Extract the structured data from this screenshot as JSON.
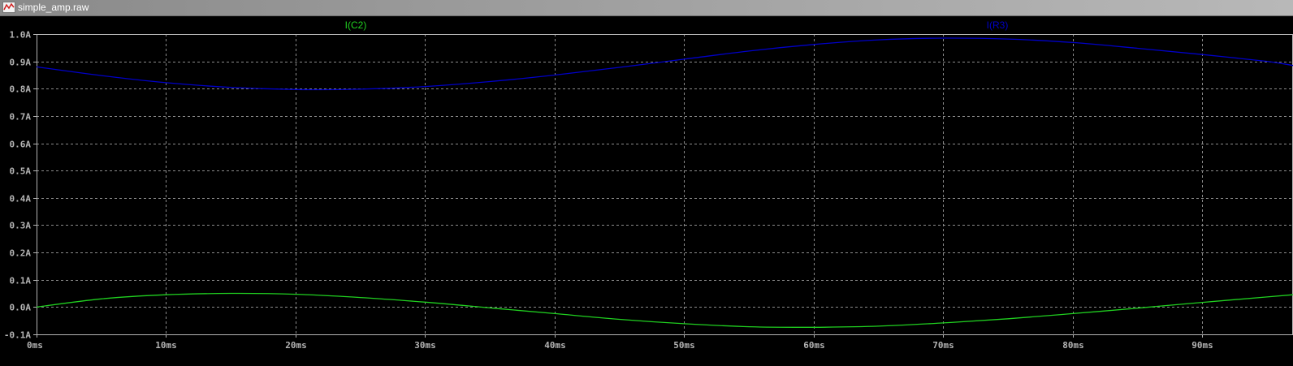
{
  "window": {
    "title": "simple_amp.raw",
    "icon": "waveform-icon"
  },
  "colors": {
    "background": "#000000",
    "grid": "#8c8c8c",
    "axis": "#b4b4b4",
    "ic2": "#20d020",
    "ir3": "#0000c8"
  },
  "chart_data": {
    "type": "line",
    "title": "",
    "xlabel": "",
    "ylabel": "",
    "xlim": [
      0,
      97
    ],
    "ylim": [
      -0.1,
      1.0
    ],
    "grid": true,
    "x_unit": "ms",
    "y_unit": "A",
    "x_ticks": [
      0,
      10,
      20,
      30,
      40,
      50,
      60,
      70,
      80,
      90
    ],
    "x_tick_labels": [
      "0ms",
      "10ms",
      "20ms",
      "30ms",
      "40ms",
      "50ms",
      "60ms",
      "70ms",
      "80ms",
      "90ms"
    ],
    "y_ticks": [
      1.0,
      0.9,
      0.8,
      0.7,
      0.6,
      0.5,
      0.4,
      0.3,
      0.2,
      0.1,
      0.0,
      -0.1
    ],
    "y_tick_labels": [
      "1.0A",
      "0.9A",
      "0.8A",
      "0.7A",
      "0.6A",
      "0.5A",
      "0.4A",
      "0.3A",
      "0.2A",
      "0.1A",
      "0.0A",
      "-0.1A"
    ],
    "series": [
      {
        "name": "I(C2)",
        "color": "#20d020",
        "x": [
          0,
          5,
          10,
          15,
          20,
          25,
          30,
          35,
          40,
          45,
          50,
          55,
          60,
          65,
          70,
          75,
          80,
          85,
          90,
          95,
          97
        ],
        "y": [
          0.0,
          0.03,
          0.045,
          0.05,
          0.047,
          0.035,
          0.018,
          -0.003,
          -0.024,
          -0.045,
          -0.061,
          -0.072,
          -0.074,
          -0.07,
          -0.058,
          -0.043,
          -0.024,
          -0.004,
          0.017,
          0.037,
          0.045
        ]
      },
      {
        "name": "I(R3)",
        "color": "#0000c8",
        "x": [
          0,
          5,
          10,
          15,
          20,
          25,
          30,
          35,
          40,
          45,
          50,
          55,
          60,
          65,
          70,
          75,
          80,
          85,
          90,
          95,
          97
        ],
        "y": [
          0.88,
          0.848,
          0.822,
          0.805,
          0.797,
          0.798,
          0.808,
          0.826,
          0.85,
          0.878,
          0.908,
          0.938,
          0.962,
          0.979,
          0.985,
          0.982,
          0.969,
          0.948,
          0.925,
          0.9,
          0.885
        ]
      }
    ]
  }
}
